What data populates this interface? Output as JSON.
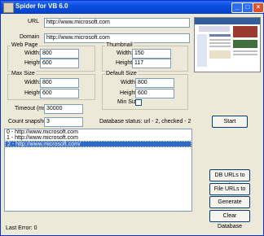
{
  "window": {
    "title": "Spider for VB 6.0"
  },
  "labels": {
    "url": "URL",
    "domain": "Domain",
    "width": "Width:",
    "height": "Height:",
    "timeout": "Timeout (ms):",
    "count_snapshots": "Count snapshots:",
    "min_size": "Min Size:",
    "database_status": "Database status: url - 2, checked - 2",
    "last_error": "Last Error: 0"
  },
  "fields": {
    "url": "http://www.microsoft.com",
    "domain": "http://www.microsoft.com",
    "timeout": "30000",
    "count_snapshots": "3"
  },
  "groups": {
    "web_page": {
      "title": "Web Page",
      "width": "800",
      "height": "600"
    },
    "thumbnail": {
      "title": "Thumbnail",
      "width": "150",
      "height": "117"
    },
    "max_size": {
      "title": "Max Size",
      "width": "800",
      "height": "600"
    },
    "default_size": {
      "title": "Default Size",
      "width": "800",
      "height": "600"
    }
  },
  "list": {
    "items": [
      "0 - http://www.microsoft.com",
      "1 - http://www.microsoft.com",
      "2 - http://www.microsoft.com/"
    ],
    "selected_index": 2
  },
  "buttons": {
    "start": "Start",
    "db_urls_to_file": "DB URLs to File",
    "file_urls_to_db": "File URLs to DB",
    "generate_html": "Generate HTML",
    "clear_database": "Clear Database"
  },
  "colors": {
    "titlebar": "#0a4ee0",
    "selection": "#316ac5"
  }
}
